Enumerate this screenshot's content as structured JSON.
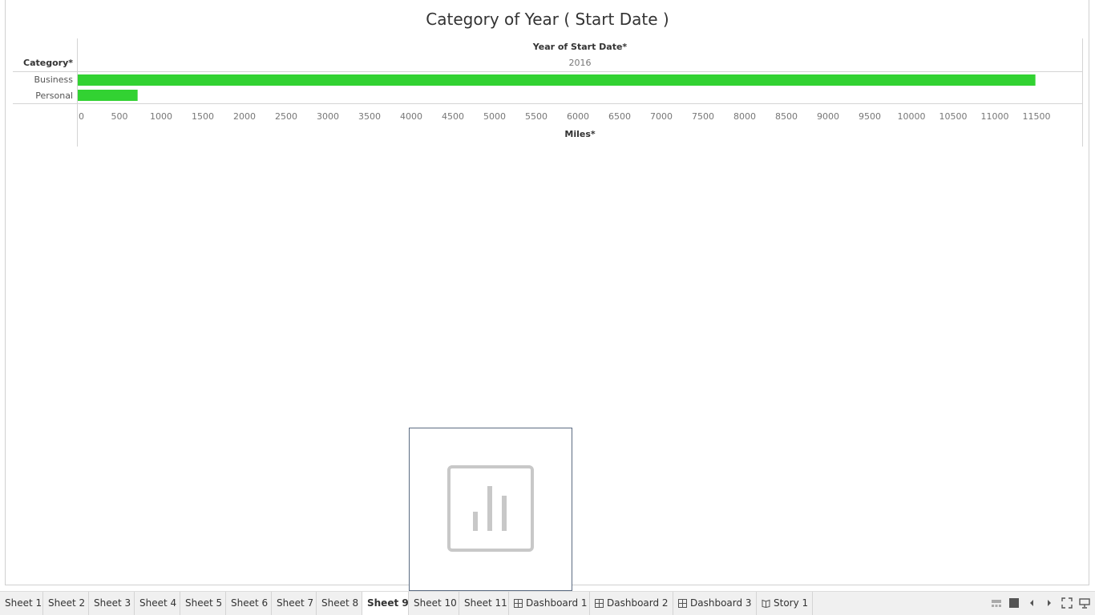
{
  "title": "Category of Year ( Start Date )",
  "column_header": "Year of Start Date*",
  "column_value": "2016",
  "row_header": "Category*",
  "axis_title": "Miles*",
  "colors": {
    "bar": "#32d232",
    "grid": "#d4d4d4",
    "placeholder_border": "#5b6b82"
  },
  "chart_data": {
    "type": "bar",
    "orientation": "horizontal",
    "categories": [
      "Business",
      "Personal"
    ],
    "values": [
      11487,
      718
    ],
    "xlabel": "Miles*",
    "ylabel": "Category*",
    "xlim": [
      0,
      12000
    ],
    "ticks": [
      0,
      500,
      1000,
      1500,
      2000,
      2500,
      3000,
      3500,
      4000,
      4500,
      5000,
      5500,
      6000,
      6500,
      7000,
      7500,
      8000,
      8500,
      9000,
      9500,
      10000,
      10500,
      11000,
      11500
    ],
    "column_facet": "2016",
    "grid": false
  },
  "placeholder": {
    "icon": "bar-chart-icon"
  },
  "tabs": [
    {
      "label": "Sheet 1",
      "icon": ""
    },
    {
      "label": "Sheet 2",
      "icon": ""
    },
    {
      "label": "Sheet 3",
      "icon": ""
    },
    {
      "label": "Sheet 4",
      "icon": ""
    },
    {
      "label": "Sheet 5",
      "icon": ""
    },
    {
      "label": "Sheet 6",
      "icon": ""
    },
    {
      "label": "Sheet 7",
      "icon": ""
    },
    {
      "label": "Sheet 8",
      "icon": ""
    },
    {
      "label": "Sheet 9",
      "icon": "",
      "active": true
    },
    {
      "label": "Sheet 10",
      "icon": ""
    },
    {
      "label": "Sheet 11",
      "icon": ""
    },
    {
      "label": "Dashboard 1",
      "icon": "dashboard-icon"
    },
    {
      "label": "Dashboard 2",
      "icon": "dashboard-icon"
    },
    {
      "label": "Dashboard 3",
      "icon": "dashboard-icon"
    },
    {
      "label": "Story 1",
      "icon": "story-icon"
    }
  ],
  "controls": [
    "show-filmstrip-icon",
    "show-tabs-icon",
    "previous-sheet-icon",
    "next-sheet-icon",
    "fullscreen-icon",
    "presentation-mode-icon"
  ]
}
